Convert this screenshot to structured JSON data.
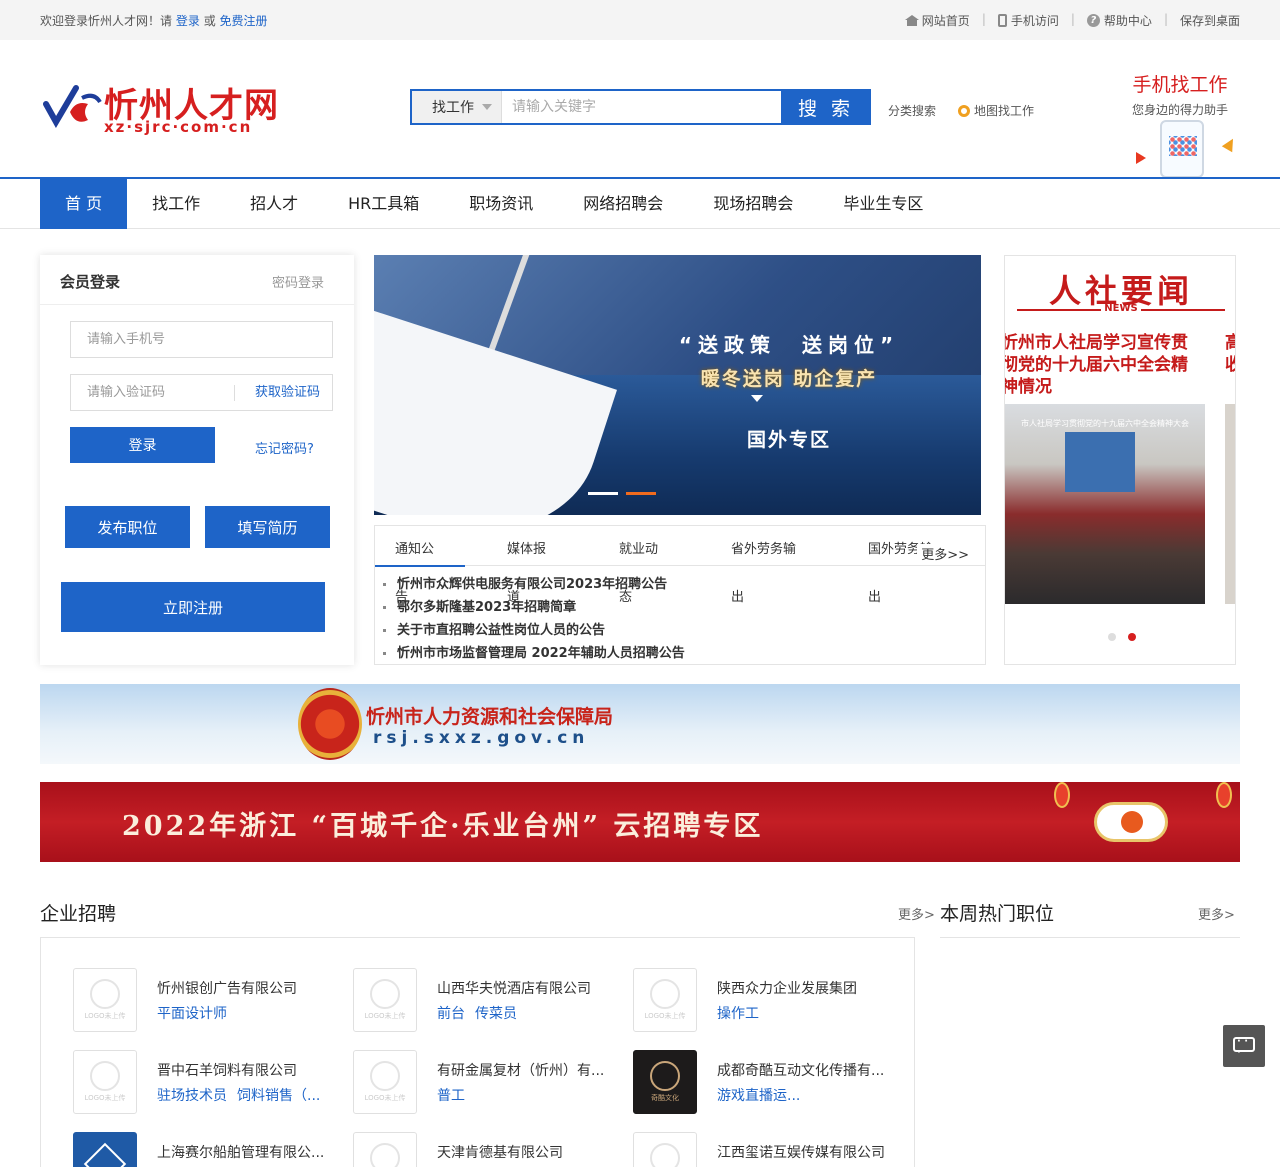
{
  "topbar": {
    "welcome_prefix": "欢迎登录忻州人才网！请",
    "login": "登录",
    "or": "或",
    "register": "免费注册",
    "links": [
      "网站首页",
      "手机访问",
      "帮助中心",
      "保存到桌面"
    ]
  },
  "header": {
    "logo_name": "忻州人才网",
    "logo_url": "xz·sjrc·com·cn",
    "search_type": "找工作",
    "search_placeholder": "请输入关键字",
    "search_button": "搜 索",
    "category_search": "分类搜索",
    "map_search": "地图找工作",
    "mobile_title": "手机找工作",
    "mobile_sub": "您身边的得力助手"
  },
  "nav": [
    "首 页",
    "找工作",
    "招人才",
    "HR工具箱",
    "职场资讯",
    "网络招聘会",
    "现场招聘会",
    "毕业生专区"
  ],
  "login": {
    "title": "会员登录",
    "alt": "密码登录",
    "phone_placeholder": "请输入手机号",
    "code_placeholder": "请输入验证码",
    "get_code": "获取验证码",
    "login_button": "登录",
    "forgot": "忘记密码?",
    "post_job": "发布职位",
    "fill_resume": "填写简历",
    "register_now": "立即注册"
  },
  "slider": {
    "line1": "“送政策　送岗位”",
    "line2": "暖冬送岗 助企复产",
    "line3": "国外专区"
  },
  "news": {
    "tabs": [
      "通知公告",
      "媒体报道",
      "就业动态",
      "省外劳务输出",
      "国外劳务输出"
    ],
    "more": "更多>>",
    "items": [
      "忻州市众辉供电服务有限公司2023年招聘公告",
      "鄂尔多斯隆基2023年招聘简章",
      "关于市直招聘公益性岗位人员的公告",
      "忻州市市场监督管理局 2022年辅助人员招聘公告"
    ]
  },
  "rsnews": {
    "title": "人社要闻",
    "tag": "NEWS",
    "headline": "忻州市人社局学习宣传贯彻党的十九届六中全会精神情况",
    "headline2": "高服收",
    "photo_caption": "市人社局学习贯彻党的十九届六中全会精神大会"
  },
  "banner1": {
    "title": "忻州市人力资源和社会保障局",
    "url": "rsj.sxxz.gov.cn"
  },
  "banner2": {
    "text": "2022年浙江 “百城千企·乐业台州” 云招聘专区"
  },
  "companies_section": {
    "title": "企业招聘",
    "more": "更多>"
  },
  "hot_section": {
    "title": "本周热门职位",
    "more": "更多>"
  },
  "logo_placeholder": "LOGO未上传",
  "companies": [
    {
      "name": "忻州银创广告有限公司",
      "posts": [
        "平面设计师"
      ],
      "logo": "placeholder"
    },
    {
      "name": "山西华夫悦酒店有限公司",
      "posts": [
        "前台",
        "传菜员"
      ],
      "logo": "placeholder"
    },
    {
      "name": "陕西众力企业发展集团",
      "posts": [
        "操作工"
      ],
      "logo": "placeholder"
    },
    {
      "name": "晋中石羊饲料有限公司",
      "posts": [
        "驻场技术员",
        "饲料销售（..."
      ],
      "logo": "placeholder"
    },
    {
      "name": "有研金属复材（忻州）有...",
      "posts": [
        "普工"
      ],
      "logo": "placeholder"
    },
    {
      "name": "成都奇酷互动文化传播有...",
      "posts": [
        "游戏直播运..."
      ],
      "logo": "dark",
      "logo_text": "奇酷文化"
    },
    {
      "name": "上海赛尔船舶管理有限公...",
      "posts": [],
      "logo": "blue"
    },
    {
      "name": "天津肯德基有限公司",
      "posts": [],
      "logo": "placeholder"
    },
    {
      "name": "江西玺诺互娱传媒有限公司",
      "posts": [],
      "logo": "placeholder"
    }
  ]
}
